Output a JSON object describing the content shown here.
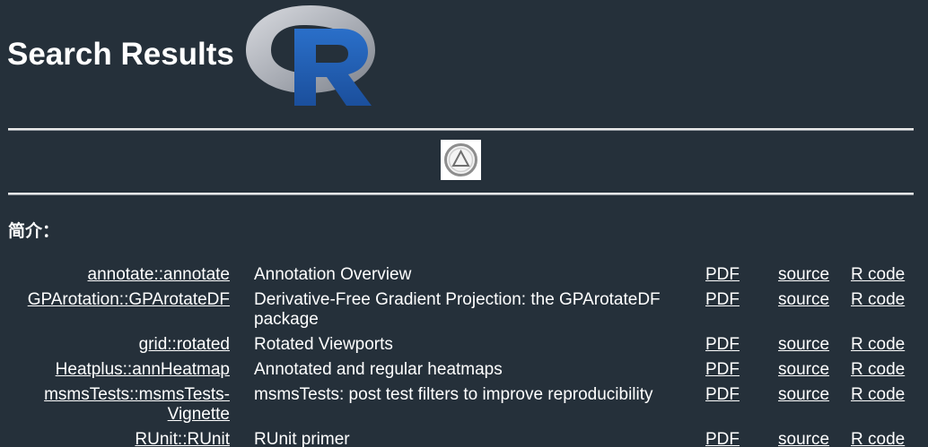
{
  "header": {
    "title": "Search Results",
    "logo_icon": "r-logo-icon"
  },
  "center_icon": "circled-triangle-icon",
  "intro": {
    "label": "简介："
  },
  "results": [
    {
      "package": "annotate::annotate",
      "description": "Annotation Overview",
      "pdf": "PDF",
      "source": "source",
      "rcode": "R code"
    },
    {
      "package": "GPArotation::GPArotateDF",
      "description": "Derivative-Free Gradient Projection: the GPArotateDF package",
      "pdf": "PDF",
      "source": "source",
      "rcode": "R code"
    },
    {
      "package": "grid::rotated",
      "description": "Rotated Viewports",
      "pdf": "PDF",
      "source": "source",
      "rcode": "R code"
    },
    {
      "package": "Heatplus::annHeatmap",
      "description": "Annotated and regular heatmaps",
      "pdf": "PDF",
      "source": "source",
      "rcode": "R code"
    },
    {
      "package": "msmsTests::msmsTests-Vignette",
      "description": "msmsTests: post test filters to improve reproducibility",
      "pdf": "PDF",
      "source": "source",
      "rcode": "R code"
    },
    {
      "package": "RUnit::RUnit",
      "description": "RUnit primer",
      "pdf": "PDF",
      "source": "source",
      "rcode": "R code"
    }
  ],
  "colors": {
    "background": "#25303a",
    "text": "#ffffff",
    "r_logo_blue": "#1f5fb5",
    "r_logo_ring": "#b9bcc4"
  }
}
